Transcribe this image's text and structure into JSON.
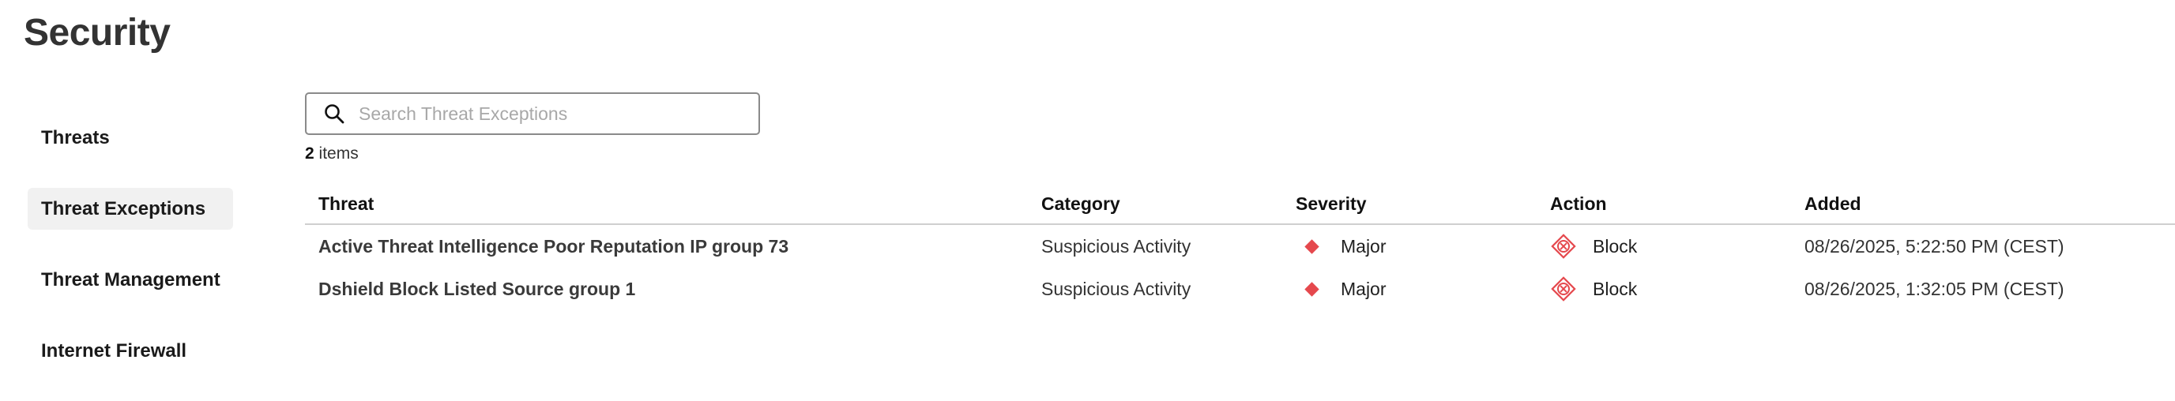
{
  "page": {
    "title": "Security"
  },
  "sidebar": {
    "items": [
      {
        "label": "Threats",
        "active": false
      },
      {
        "label": "Threat Exceptions",
        "active": true
      },
      {
        "label": "Threat Management",
        "active": false
      },
      {
        "label": "Internet Firewall",
        "active": false
      }
    ]
  },
  "search": {
    "placeholder": "Search Threat Exceptions",
    "value": "",
    "icon": "search-icon"
  },
  "results": {
    "count": "2",
    "count_label": "items"
  },
  "table": {
    "columns": [
      "Threat",
      "Category",
      "Severity",
      "Action",
      "Added"
    ],
    "rows": [
      {
        "threat": "Active Threat Intelligence Poor Reputation IP group 73",
        "category": "Suspicious Activity",
        "severity": "Major",
        "action": "Block",
        "added": "08/26/2025, 5:22:50 PM (CEST)"
      },
      {
        "threat": "Dshield Block Listed Source group 1",
        "category": "Suspicious Activity",
        "severity": "Major",
        "action": "Block",
        "added": "08/26/2025, 1:32:05 PM (CEST)"
      }
    ]
  },
  "colors": {
    "severity_major": "#e5484d",
    "action_block": "#e5484d",
    "active_nav_bg": "#f1f1f1"
  }
}
